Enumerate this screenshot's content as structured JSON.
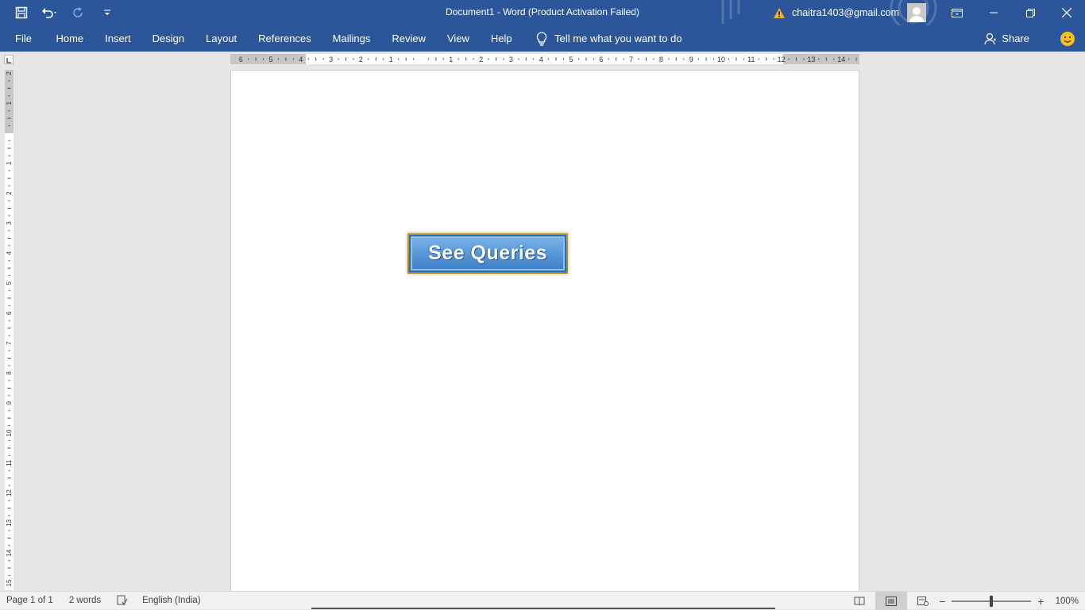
{
  "titlebar": {
    "title": "Document1  -  Word (Product Activation Failed)",
    "account": "chaitra1403@gmail.com",
    "qat_icons": [
      "save-icon",
      "undo-icon",
      "redo-icon",
      "customize-qat-icon"
    ],
    "window_icons": [
      "ribbon-display-icon",
      "minimize-icon",
      "restore-icon",
      "close-icon"
    ]
  },
  "ribbon": {
    "tabs": [
      "File",
      "Home",
      "Insert",
      "Design",
      "Layout",
      "References",
      "Mailings",
      "Review",
      "View",
      "Help"
    ],
    "tell_me": "Tell me what you want to do",
    "share": "Share"
  },
  "document": {
    "button_text": "See Queries"
  },
  "statusbar": {
    "page": "Page 1 of 1",
    "words": "2 words",
    "language": "English (India)",
    "zoom": "100%",
    "zoom_level": 1.0
  },
  "colors": {
    "accent": "#2b579a",
    "button_fill": "#5b9bdc",
    "button_border": "#c49a2a"
  }
}
